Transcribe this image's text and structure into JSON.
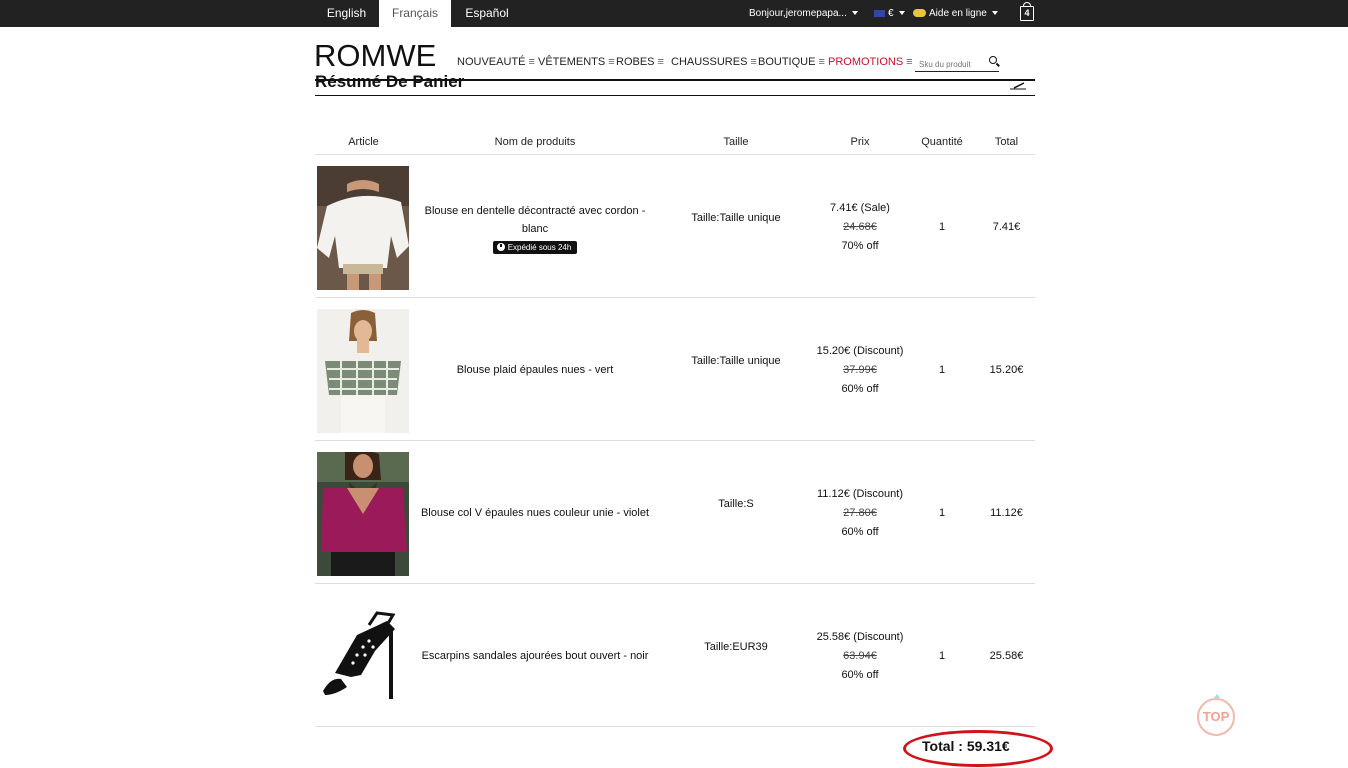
{
  "topbar": {
    "languages": [
      "English",
      "Français",
      "Español"
    ],
    "active_language": "Français",
    "user_greeting": "Bonjour,jeromepapa...",
    "currency": "€",
    "help": "Aide en ligne",
    "cart_count": "4"
  },
  "header": {
    "logo": "ROMWE",
    "nav": [
      "NOUVEAUTÉ",
      "VÊTEMENTS",
      "ROBES",
      "CHAUSSURES",
      "BOUTIQUE",
      "PROMOTIONS"
    ],
    "nav_separator": "≡",
    "search_placeholder": "Sku du produit"
  },
  "section": {
    "title": "Résumé De Panier"
  },
  "table": {
    "headers": [
      "Article",
      "Nom de produits",
      "Taille",
      "Prix",
      "Quantité",
      "Total"
    ],
    "rows": [
      {
        "name_line1": "Blouse en dentelle décontracté avec cordon -",
        "name_line2": "blanc",
        "badge": "Expédié sous 24h",
        "size": "Taille:Taille unique",
        "price": "7.41€ (Sale)",
        "old_price": "24.68€",
        "off": "70% off",
        "qty": "1",
        "total": "7.41€"
      },
      {
        "name_line1": "Blouse plaid épaules nues - vert",
        "size": "Taille:Taille unique",
        "price": "15.20€ (Discount)",
        "old_price": "37.99€",
        "off": "60% off",
        "qty": "1",
        "total": "15.20€"
      },
      {
        "name_line1": "Blouse col V épaules nues couleur unie - violet",
        "size": "Taille:S",
        "price": "11.12€ (Discount)",
        "old_price": "27.80€",
        "off": "60% off",
        "qty": "1",
        "total": "11.12€"
      },
      {
        "name_line1": "Escarpins sandales ajourées bout ouvert - noir",
        "size": "Taille:EUR39",
        "price": "25.58€ (Discount)",
        "old_price": "63.94€",
        "off": "60% off",
        "qty": "1",
        "total": "25.58€"
      }
    ]
  },
  "summary": {
    "total_label": "Total :",
    "total_value": "59.31€"
  },
  "back_to_top": "TOP",
  "colors": {
    "topbar_bg": "#222222",
    "promo": "#c8102e",
    "highlight_oval": "#d0121a"
  }
}
